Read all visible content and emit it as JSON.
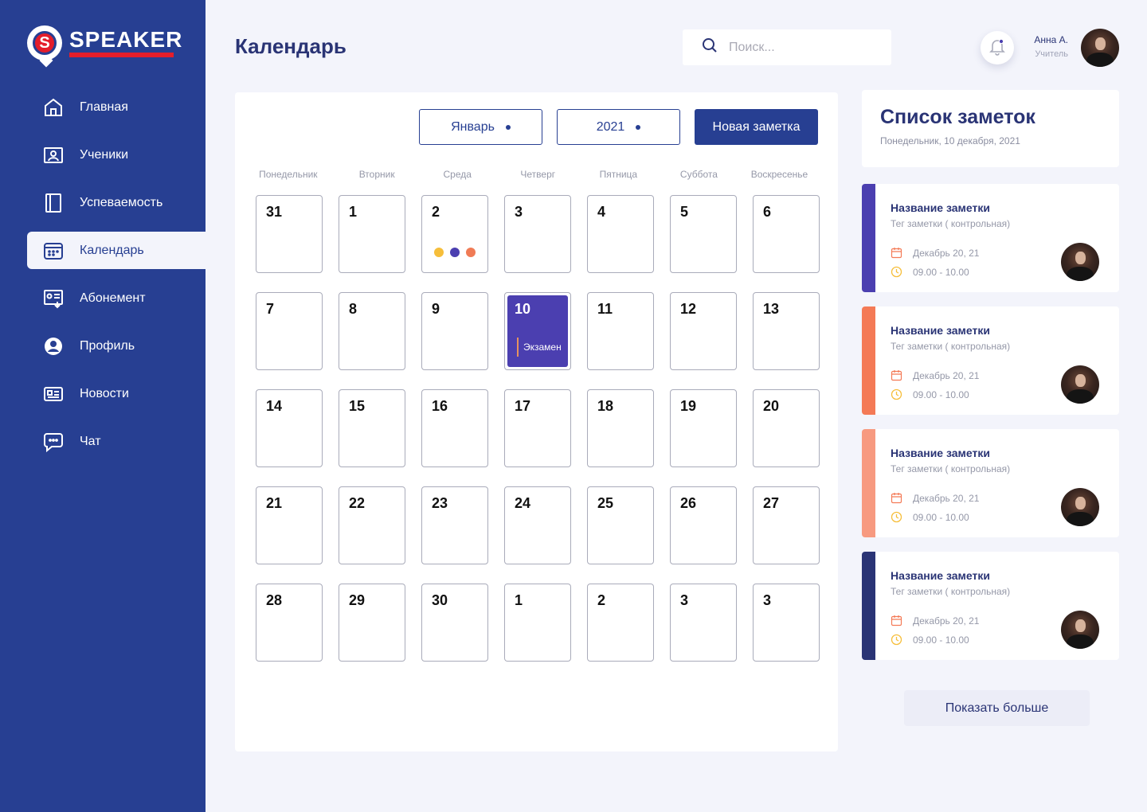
{
  "brand": {
    "name": "SPEAKER",
    "letter": "S"
  },
  "sidebar": {
    "items": [
      {
        "label": "Главная",
        "icon": "home-icon",
        "active": false
      },
      {
        "label": "Ученики",
        "icon": "students-icon",
        "active": false
      },
      {
        "label": "Успеваемость",
        "icon": "book-icon",
        "active": false
      },
      {
        "label": "Календарь",
        "icon": "calendar-icon",
        "active": true
      },
      {
        "label": "Абонемент",
        "icon": "subscription-icon",
        "active": false
      },
      {
        "label": "Профиль",
        "icon": "profile-icon",
        "active": false
      },
      {
        "label": "Новости",
        "icon": "news-icon",
        "active": false
      },
      {
        "label": "Чат",
        "icon": "chat-icon",
        "active": false
      }
    ]
  },
  "header": {
    "title": "Календарь",
    "search_placeholder": "Поиск...",
    "user_name": "Анна А.",
    "user_role": "Учитель"
  },
  "calendar": {
    "month": "Январь",
    "year": "2021",
    "new_note_label": "Новая заметка",
    "weekdays": [
      "Понедельник",
      "Вторник",
      "Среда",
      "Четверг",
      "Пятница",
      "Суббота",
      "Воскресенье"
    ],
    "weeks": [
      [
        "31",
        "1",
        "2",
        "3",
        "4",
        "5",
        "6"
      ],
      [
        "7",
        "8",
        "9",
        "10",
        "11",
        "12",
        "13"
      ],
      [
        "14",
        "15",
        "16",
        "17",
        "18",
        "19",
        "20"
      ],
      [
        "21",
        "22",
        "23",
        "24",
        "25",
        "26",
        "27"
      ],
      [
        "28",
        "29",
        "30",
        "1",
        "2",
        "3",
        "3"
      ]
    ],
    "dot_day": "2",
    "dot_colors": [
      "#F6BE3A",
      "#4B3FB0",
      "#F07B55"
    ],
    "event_day": "10",
    "event_label": "Экзамен",
    "event_color": "#4B3FB0"
  },
  "notes": {
    "title": "Список заметок",
    "date": "Понедельник, 10 декабря, 2021",
    "items": [
      {
        "title": "Название заметки",
        "tag": "Тег заметки ( контрольная)",
        "date": "Декабрь 20, 21",
        "time": "09.00 - 10.00",
        "color": "#4B3FB0"
      },
      {
        "title": "Название заметки",
        "tag": "Тег заметки ( контрольная)",
        "date": "Декабрь 20, 21",
        "time": "09.00 - 10.00",
        "color": "#F47A56"
      },
      {
        "title": "Название заметки",
        "tag": "Тег заметки ( контрольная)",
        "date": "Декабрь 20, 21",
        "time": "09.00 - 10.00",
        "color": "#F79A80"
      },
      {
        "title": "Название заметки",
        "tag": "Тег заметки ( контрольная)",
        "date": "Декабрь 20, 21",
        "time": "09.00 - 10.00",
        "color": "#2A3475"
      }
    ],
    "show_more_label": "Показать больше"
  }
}
